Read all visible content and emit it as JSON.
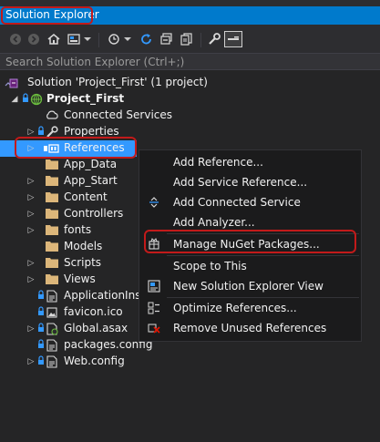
{
  "window": {
    "title": "Solution Explorer"
  },
  "toolbar": {
    "icons": [
      "back-icon",
      "forward-icon",
      "home-icon",
      "switch-views-icon",
      "dropdown-icon",
      "history-icon",
      "dropdown-icon",
      "refresh-icon",
      "collapse-all-icon",
      "show-all-files-icon",
      "properties-icon",
      "preview-icon"
    ]
  },
  "search": {
    "placeholder": "Search Solution Explorer (Ctrl+;)"
  },
  "tree": {
    "solution": "Solution 'Project_First' (1 project)",
    "project": "Project_First",
    "items": [
      {
        "label": "Connected Services",
        "icon": "cloud-icon"
      },
      {
        "label": "Properties",
        "icon": "wrench-icon"
      },
      {
        "label": "References",
        "icon": "references-icon",
        "selected": true
      },
      {
        "label": "App_Data",
        "icon": "folder-icon"
      },
      {
        "label": "App_Start",
        "icon": "folder-icon"
      },
      {
        "label": "Content",
        "icon": "folder-icon"
      },
      {
        "label": "Controllers",
        "icon": "folder-icon"
      },
      {
        "label": "fonts",
        "icon": "folder-icon"
      },
      {
        "label": "Models",
        "icon": "folder-icon"
      },
      {
        "label": "Scripts",
        "icon": "folder-icon"
      },
      {
        "label": "Views",
        "icon": "folder-icon"
      },
      {
        "label": "ApplicationInsig",
        "icon": "config-file-icon"
      },
      {
        "label": "favicon.ico",
        "icon": "image-file-icon"
      },
      {
        "label": "Global.asax",
        "icon": "asax-file-icon"
      },
      {
        "label": "packages.config",
        "icon": "config-file-icon"
      },
      {
        "label": "Web.config",
        "icon": "config-file-icon"
      }
    ]
  },
  "context_menu": {
    "items": [
      {
        "label": "Add Reference...",
        "icon": ""
      },
      {
        "label": "Add Service Reference...",
        "icon": ""
      },
      {
        "label": "Add Connected Service",
        "icon": "connected-service-icon"
      },
      {
        "label": "Add Analyzer...",
        "icon": ""
      },
      {
        "label": "Manage NuGet Packages...",
        "icon": "nuget-icon"
      },
      {
        "label": "Scope to This",
        "icon": ""
      },
      {
        "label": "New Solution Explorer View",
        "icon": "new-view-icon"
      },
      {
        "label": "Optimize References...",
        "icon": "optimize-icon"
      },
      {
        "label": "Remove Unused References",
        "icon": "remove-references-icon"
      }
    ]
  },
  "colors": {
    "background": "#252526",
    "accent": "#007acc",
    "selection": "#3399ff",
    "highlight": "#c21a1a",
    "folder": "#dcb67a"
  }
}
